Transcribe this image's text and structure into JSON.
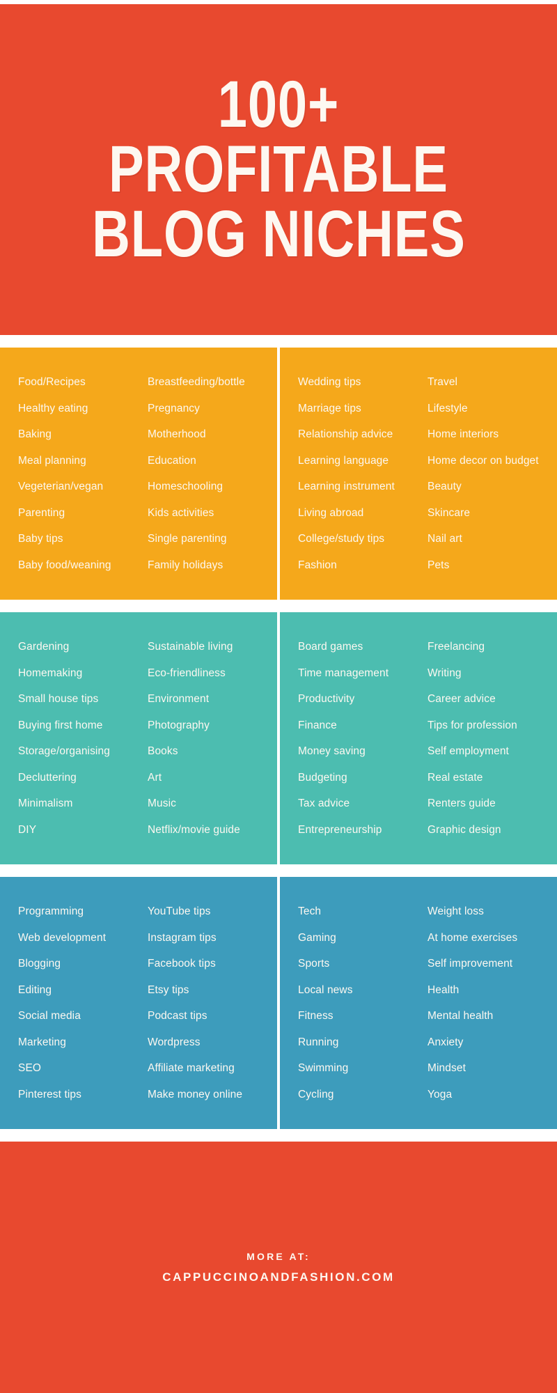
{
  "header": {
    "title_line1": "100+",
    "title_line2": "PROFITABLE",
    "title_line3": "BLOG NICHES",
    "background_color": "#E8492F",
    "text_color": "#FDF8F1"
  },
  "bands": [
    {
      "name": "lifestyle-family-band",
      "color": "#F5A81B",
      "panels": [
        {
          "name": "food-family-panel",
          "columns": [
            [
              "Food/Recipes",
              "Healthy eating",
              "Baking",
              "Meal planning",
              "Vegeterian/vegan",
              "Parenting",
              "Baby tips",
              "Baby food/weaning"
            ],
            [
              "Breastfeeding/bottle",
              "Pregnancy",
              "Motherhood",
              "Education",
              "Homeschooling",
              "Kids activities",
              "Single parenting",
              "Family holidays"
            ]
          ]
        },
        {
          "name": "relationships-lifestyle-panel",
          "columns": [
            [
              "Wedding tips",
              "Marriage tips",
              "Relationship advice",
              "Learning language",
              "Learning instrument",
              "Living abroad",
              "College/study tips",
              "Fashion"
            ],
            [
              "Travel",
              "Lifestyle",
              "Home interiors",
              "Home decor on budget",
              "Beauty",
              "Skincare",
              "Nail art",
              "Pets"
            ]
          ]
        }
      ]
    },
    {
      "name": "home-business-band",
      "color": "#4CBDB0",
      "panels": [
        {
          "name": "home-hobbies-panel",
          "columns": [
            [
              "Gardening",
              "Homemaking",
              "Small house tips",
              "Buying first home",
              "Storage/organising",
              "Decluttering",
              "Minimalism",
              "DIY"
            ],
            [
              "Sustainable living",
              "Eco-friendliness",
              "Environment",
              "Photography",
              "Books",
              "Art",
              "Music",
              "Netflix/movie guide"
            ]
          ]
        },
        {
          "name": "business-finance-panel",
          "columns": [
            [
              "Board games",
              "Time management",
              "Productivity",
              "Finance",
              "Money saving",
              "Budgeting",
              "Tax advice",
              "Entrepreneurship"
            ],
            [
              "Freelancing",
              "Writing",
              "Career advice",
              "Tips for profession",
              "Self employment",
              "Real estate",
              "Renters guide",
              "Graphic design"
            ]
          ]
        }
      ]
    },
    {
      "name": "tech-health-band",
      "color": "#3D9CBC",
      "panels": [
        {
          "name": "tech-social-panel",
          "columns": [
            [
              "Programming",
              "Web development",
              "Blogging",
              "Editing",
              "Social media",
              "Marketing",
              "SEO",
              "Pinterest tips"
            ],
            [
              "YouTube tips",
              "Instagram tips",
              "Facebook tips",
              "Etsy tips",
              "Podcast tips",
              "Wordpress",
              "Affiliate marketing",
              "Make money online"
            ]
          ]
        },
        {
          "name": "sports-health-panel",
          "columns": [
            [
              "Tech",
              "Gaming",
              "Sports",
              "Local news",
              "Fitness",
              "Running",
              "Swimming",
              "Cycling"
            ],
            [
              "Weight loss",
              "At home exercises",
              "Self improvement",
              "Health",
              "Mental health",
              "Anxiety",
              "Mindset",
              "Yoga"
            ]
          ]
        }
      ]
    }
  ],
  "footer": {
    "more_at_label": "MORE AT:",
    "url": "CAPPUCCINOANDFASHION.COM",
    "background_color": "#E8492F",
    "text_color": "#FDF8F1"
  }
}
